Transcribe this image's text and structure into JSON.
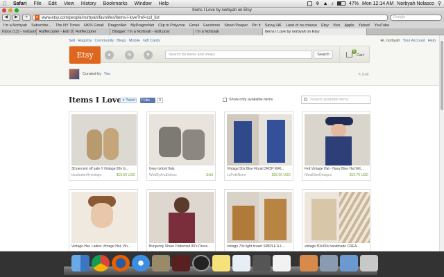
{
  "menubar": {
    "app": "Safari",
    "menus": [
      "File",
      "Edit",
      "View",
      "History",
      "Bookmarks",
      "Window",
      "Help"
    ],
    "battery": "47%",
    "clock": "Mon 12:14 AM",
    "user": "Norbyah Nolasco"
  },
  "browser": {
    "window_title": "Items I Love by norbyah on Etsy",
    "url": "www.etsy.com/people/norbyah/favorites/items-i-love?ref=col_list",
    "search_placeholder": "Google",
    "bookmarks": [
      "I'm a Norbyah",
      "Subscribe...",
      "The NY Times",
      "HKIS Gmail",
      "DragonNet",
      "MyDragonNet",
      "Clip to Polyvore",
      "Gmail",
      "Facebook",
      "Street Peeper",
      "Pin It",
      "Savvy HK",
      "Land of no cheese",
      "Etsy",
      "Vivo",
      "Apple",
      "Yahoo!",
      "YouTube"
    ],
    "tabs": [
      "Inbox (12) - norbyahnolasco@gmail.c...",
      "Rafflecopter - Edit Details",
      "Rafflecopter",
      "Blogger: I'm a Norbyah - Edit post",
      "I'm a Norbyah",
      "Items I Love by norbyah on Etsy"
    ]
  },
  "etsy": {
    "top_links": [
      "Sell",
      "Registry",
      "Community",
      "Blogs",
      "Mobile",
      "Gift Cards"
    ],
    "account_links": [
      "Hi, norbyah",
      "Your Account",
      "Help"
    ],
    "logo": "Etsy",
    "search_placeholder": "Search for items and shops",
    "search_button": "Search",
    "cart_count": "0",
    "cart_label": "Cart",
    "curated_prefix": "Curated by",
    "curated_name": "You",
    "edit_label": "Edit",
    "list_title": "Items I Love",
    "tweet_label": "Tweet",
    "like_label": "Like",
    "like_count": "0",
    "available_label": "Show only available items",
    "search_items_placeholder": "Search available items",
    "items": [
      {
        "title": "30 percent off sale // Vintage 80s G...",
        "shop": "bluebutterflyvintage",
        "price": "$19.60 USD"
      },
      {
        "title": "Grey oxford flats",
        "shop": "WebByAnaDahan",
        "price": "Sold"
      },
      {
        "title": "Vintage 50s Blue Floral DROP WAI...",
        "shop": "LePetitNoire",
        "price": "$35.00 USD"
      },
      {
        "title": "Felt Vintage Hat - Navy Blue Hat Wit...",
        "shop": "NinaEliseDesigns",
        "price": "$19.70 USD"
      },
      {
        "title": "Vintage Hat, Ladies Vintage Hat, Vin...",
        "shop": "",
        "price": ""
      },
      {
        "title": "Burgundy Sheer Patterned 80's Dress...",
        "shop": "",
        "price": ""
      },
      {
        "title": "vintage 70s light brown SIMPLE A-L...",
        "shop": "",
        "price": ""
      },
      {
        "title": "vintage 50s/60s handmade CREA...",
        "shop": "",
        "price": ""
      }
    ]
  },
  "colors": {
    "etsy_orange": "#e0661e",
    "link_blue": "#3c73b1",
    "price_green": "#78a33a"
  }
}
